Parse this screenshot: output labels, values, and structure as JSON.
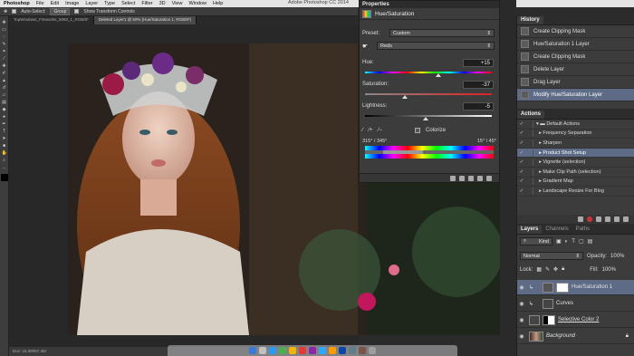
{
  "menubar": {
    "app": "Photoshop",
    "items": [
      "File",
      "Edit",
      "Image",
      "Layer",
      "Type",
      "Select",
      "Filter",
      "3D",
      "View",
      "Window",
      "Help"
    ],
    "window_title": "Adobe Photoshop CC 2014"
  },
  "options": {
    "auto_select": "Auto-Select:",
    "group": "Group",
    "show_transform": "Show Transform Controls"
  },
  "tabs": [
    "TopWindows_Fireworks_5083_1_RGB/8*",
    "Deleted Layer1 @ 50% (Hue/Saturation 1, RGB/8*)"
  ],
  "status": {
    "zoom": "Doc: 15.0M/67.4M"
  },
  "properties": {
    "title": "Properties",
    "panel_name": "Hue/Saturation",
    "preset_label": "Preset:",
    "preset_value": "Custom",
    "channel": "Reds",
    "hue_label": "Hue:",
    "hue_value": "+15",
    "sat_label": "Saturation:",
    "sat_value": "-37",
    "light_label": "Lightness:",
    "light_value": "-5",
    "colorize_label": "Colorize",
    "range_left": "315° / 345°",
    "range_right": "15° \\ 45°"
  },
  "history": {
    "tab": "History",
    "items": [
      {
        "label": "Create Clipping Mask"
      },
      {
        "label": "Hue/Saturation 1 Layer"
      },
      {
        "label": "Create Clipping Mask"
      },
      {
        "label": "Delete Layer"
      },
      {
        "label": "Drag Layer"
      },
      {
        "label": "Modify Hue/Saturation Layer"
      }
    ]
  },
  "actions": {
    "tab": "Actions",
    "items": [
      {
        "label": "Default Actions",
        "folder": true
      },
      {
        "label": "Frequency Separation"
      },
      {
        "label": "Sharpen"
      },
      {
        "label": "Product Shot Setup"
      },
      {
        "label": "Vignette (selection)"
      },
      {
        "label": "Make Clip Path (selection)"
      },
      {
        "label": "Gradient Map"
      },
      {
        "label": "Landscape Resize For Blog"
      }
    ]
  },
  "layers": {
    "tabs": [
      "Layers",
      "Channels",
      "Paths"
    ],
    "kind": "Kind",
    "blend": "Normal",
    "opacity_label": "Opacity:",
    "opacity": "100%",
    "lock_label": "Lock:",
    "fill_label": "Fill:",
    "fill": "100%",
    "items": [
      {
        "label": "Hue/Saturation 1"
      },
      {
        "label": "Curves"
      },
      {
        "label": "Selective Color 2"
      },
      {
        "label": "Background"
      }
    ]
  }
}
